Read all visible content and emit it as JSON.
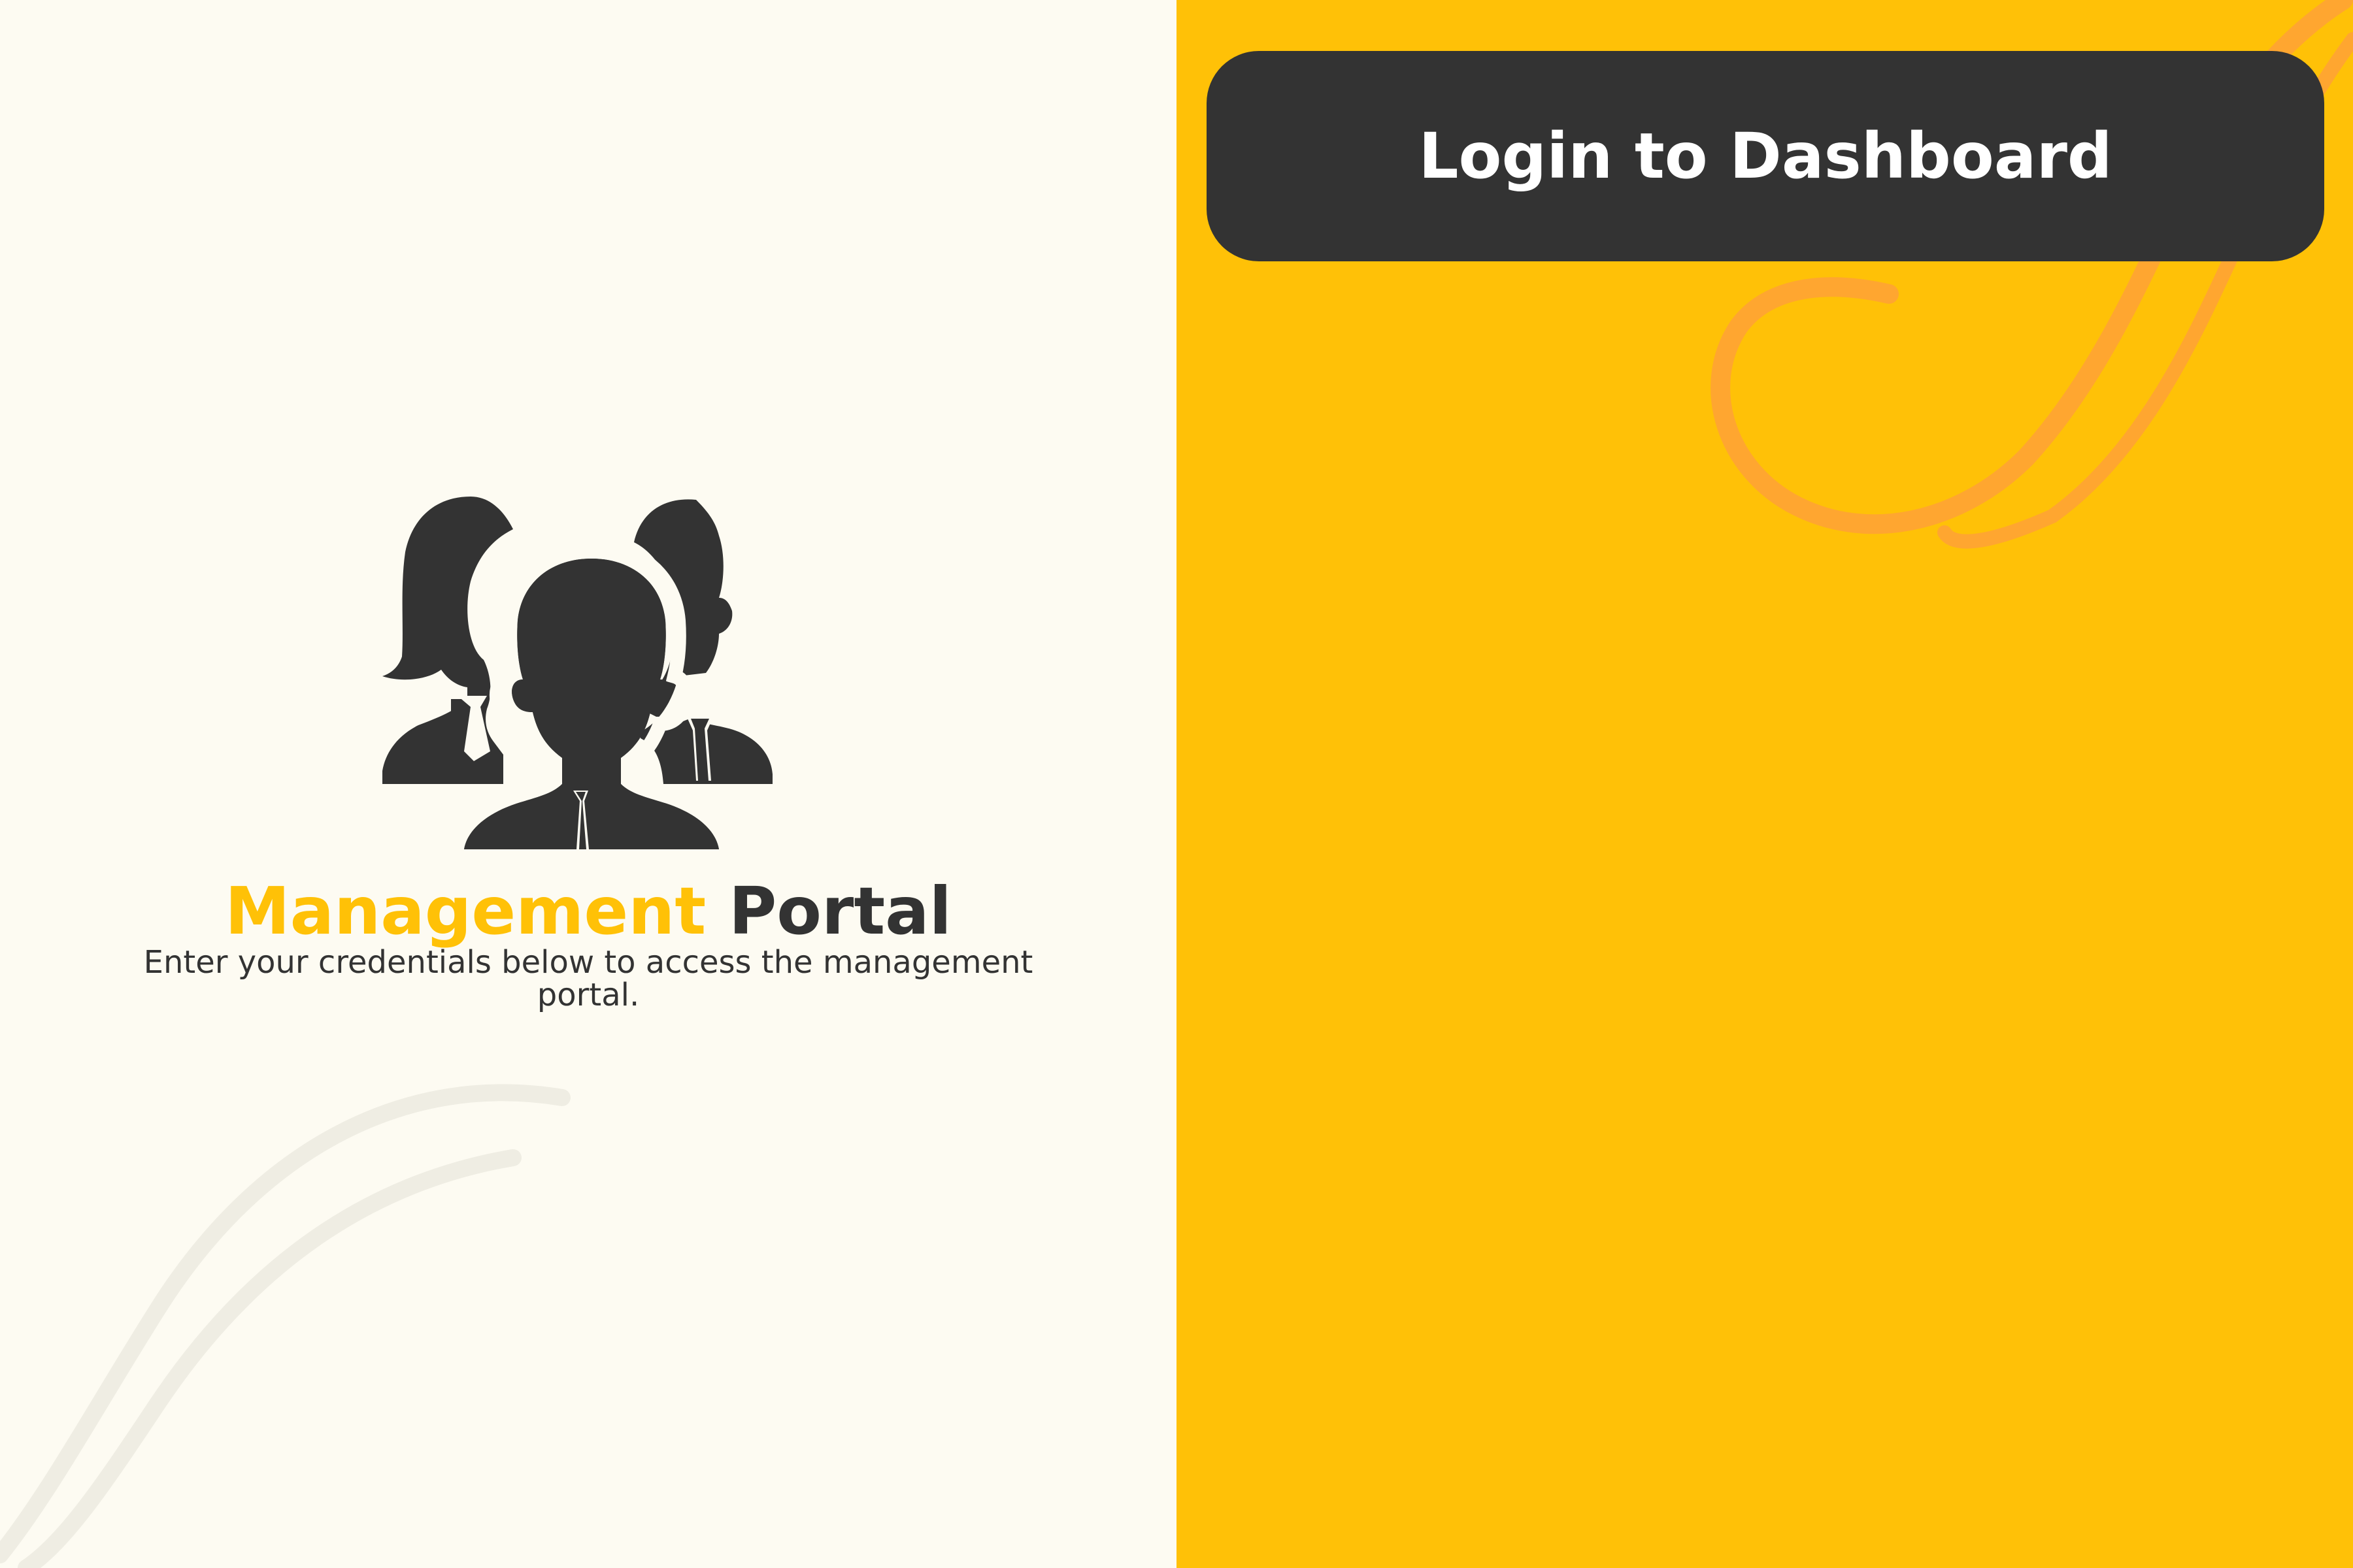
{
  "portal": {
    "title_accent": "Management",
    "title_rest": "Portal",
    "subtitle": "Enter your credentials below to access the management portal."
  },
  "login": {
    "button_label": "Login to Dashboard"
  },
  "icons": {
    "team": "team-people-icon"
  },
  "colors": {
    "accent": "#FFC107",
    "dark": "#333333",
    "left_background": "#FDFBF2",
    "swirl_orange": "#FFA630",
    "swirl_light": "#EFEDE3"
  }
}
